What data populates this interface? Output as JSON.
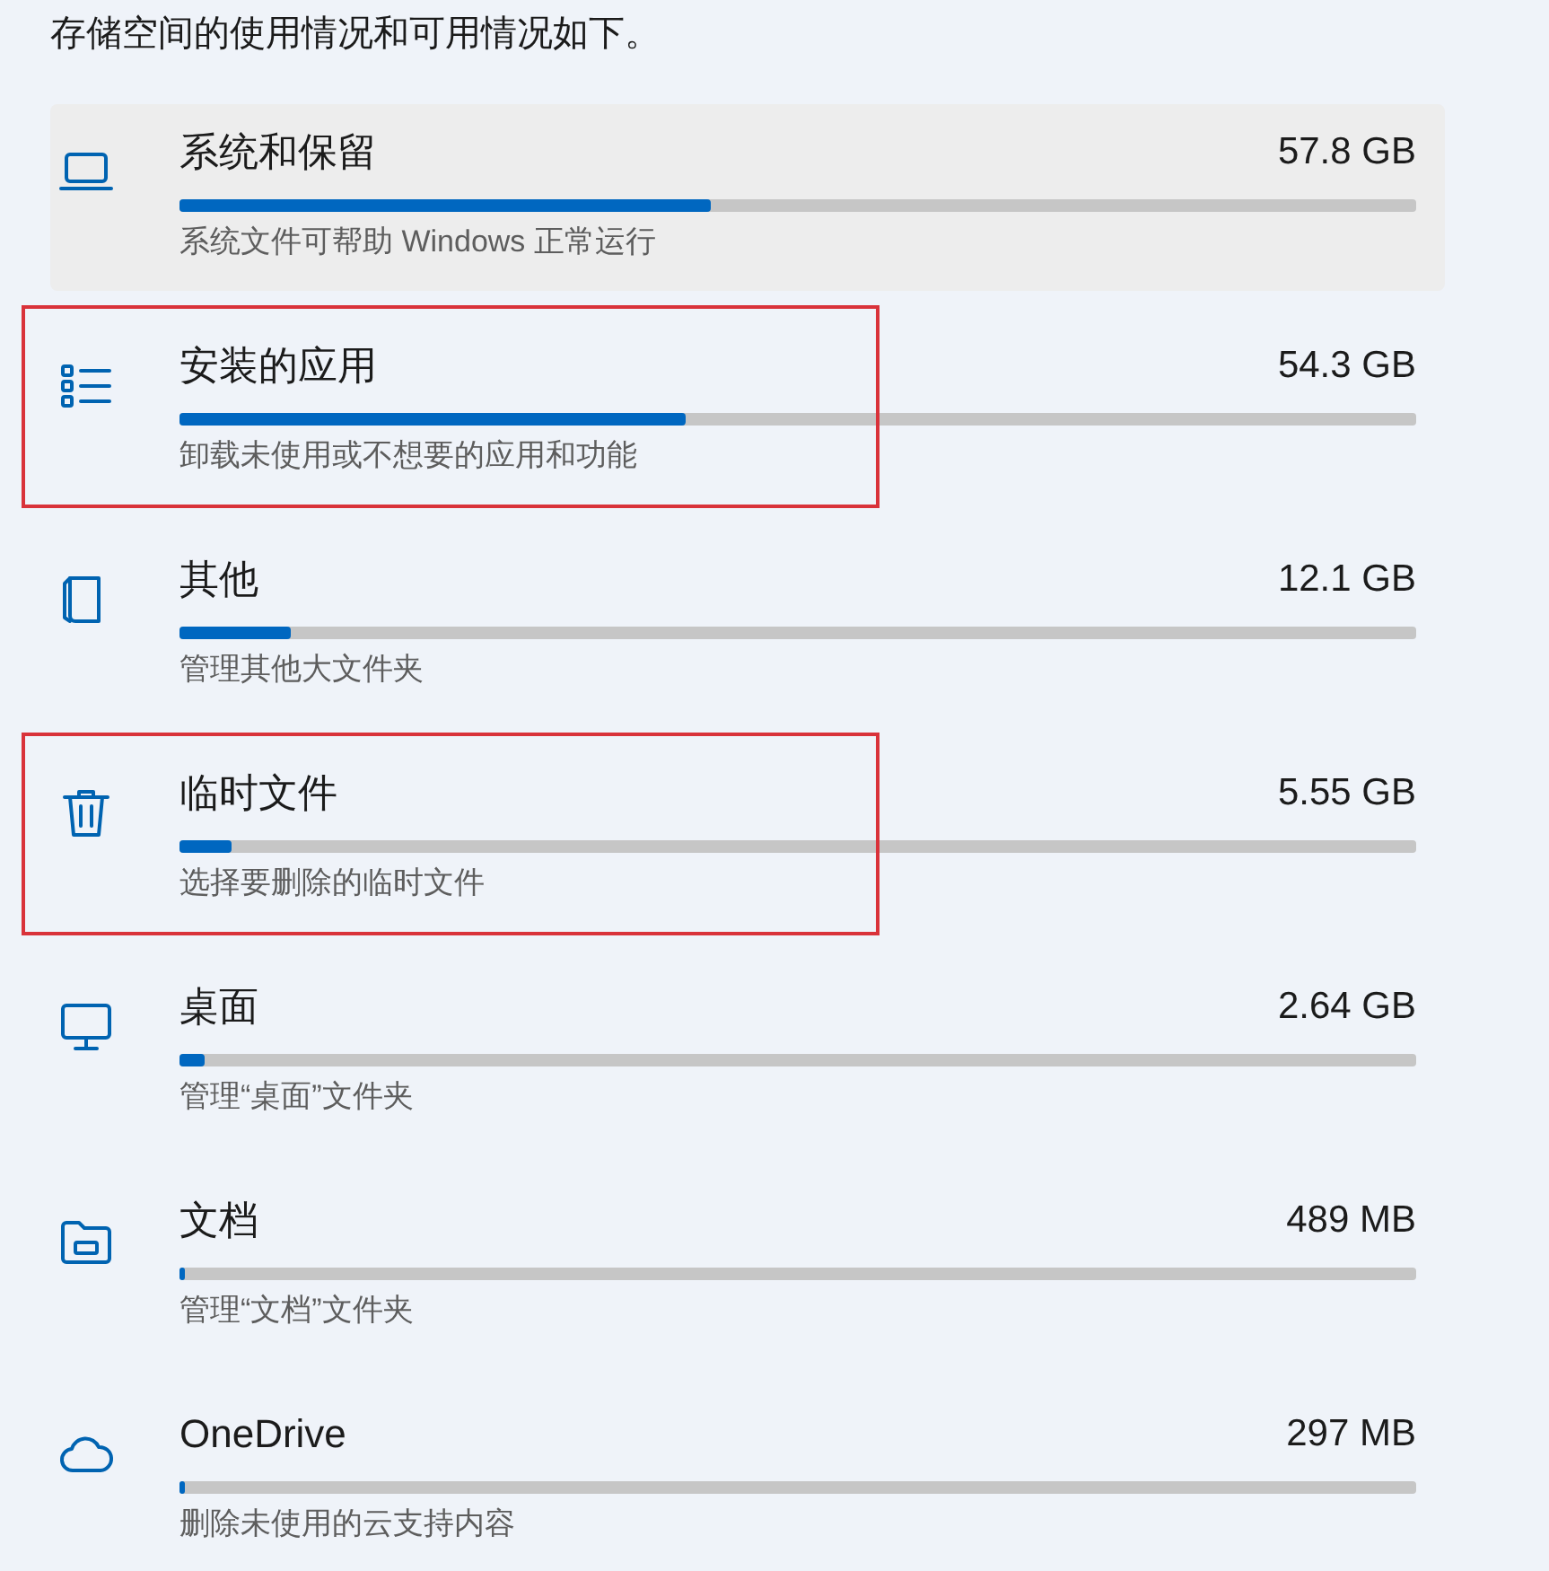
{
  "heading": "存储空间的使用情况和可用情况如下。",
  "categories": [
    {
      "title": "系统和保留",
      "size": "57.8 GB",
      "level": 0.43,
      "description": "系统文件可帮助 Windows 正常运行",
      "highlighted": true,
      "annotated": false
    },
    {
      "title": "安装的应用",
      "size": "54.3 GB",
      "level": 0.41,
      "description": "卸载未使用或不想要的应用和功能",
      "highlighted": false,
      "annotated": true
    },
    {
      "title": "其他",
      "size": "12.1 GB",
      "level": 0.09,
      "description": "管理其他大文件夹",
      "highlighted": false,
      "annotated": false
    },
    {
      "title": "临时文件",
      "size": "5.55 GB",
      "level": 0.042,
      "description": "选择要删除的临时文件",
      "highlighted": false,
      "annotated": true
    },
    {
      "title": "桌面",
      "size": "2.64 GB",
      "level": 0.02,
      "description": "管理“桌面”文件夹",
      "highlighted": false,
      "annotated": false
    },
    {
      "title": "文档",
      "size": "489 MB",
      "level": 0.004,
      "description": "管理“文档”文件夹",
      "highlighted": false,
      "annotated": false
    },
    {
      "title": "OneDrive",
      "size": "297 MB",
      "level": 0.004,
      "description": "删除未使用的云支持内容",
      "highlighted": false,
      "annotated": false
    }
  ]
}
